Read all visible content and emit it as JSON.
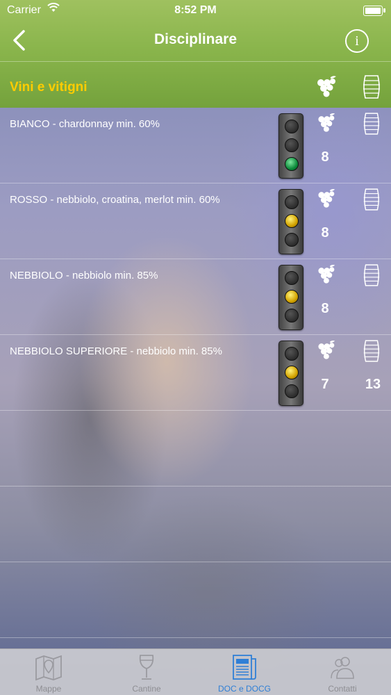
{
  "status_bar": {
    "carrier": "Carrier",
    "time": "8:52 PM"
  },
  "nav": {
    "title": "Disciplinare",
    "info_label": "i"
  },
  "section": {
    "title": "Vini e vitigni"
  },
  "rows": [
    {
      "label": "BIANCO - chardonnay min. 60%",
      "light": "green",
      "grape_value": "8",
      "barrel_value": ""
    },
    {
      "label": "ROSSO - nebbiolo, croatina, merlot min. 60%",
      "light": "yellow",
      "grape_value": "8",
      "barrel_value": ""
    },
    {
      "label": "NEBBIOLO - nebbiolo min. 85%",
      "light": "yellow",
      "grape_value": "8",
      "barrel_value": ""
    },
    {
      "label": "NEBBIOLO SUPERIORE - nebbiolo min. 85%",
      "light": "yellow",
      "grape_value": "7",
      "barrel_value": "13"
    }
  ],
  "tabs": [
    {
      "label": "Mappe",
      "icon": "map-icon"
    },
    {
      "label": "Cantine",
      "icon": "wine-glass-icon"
    },
    {
      "label": "DOC e DOCG",
      "icon": "newspaper-icon",
      "active": true
    },
    {
      "label": "Contatti",
      "icon": "contacts-icon"
    }
  ],
  "colors": {
    "header_green": "#8ab54c",
    "section_title": "#ffcc00",
    "tab_active": "#2f7fd6",
    "tab_inactive": "#8e8e93"
  }
}
